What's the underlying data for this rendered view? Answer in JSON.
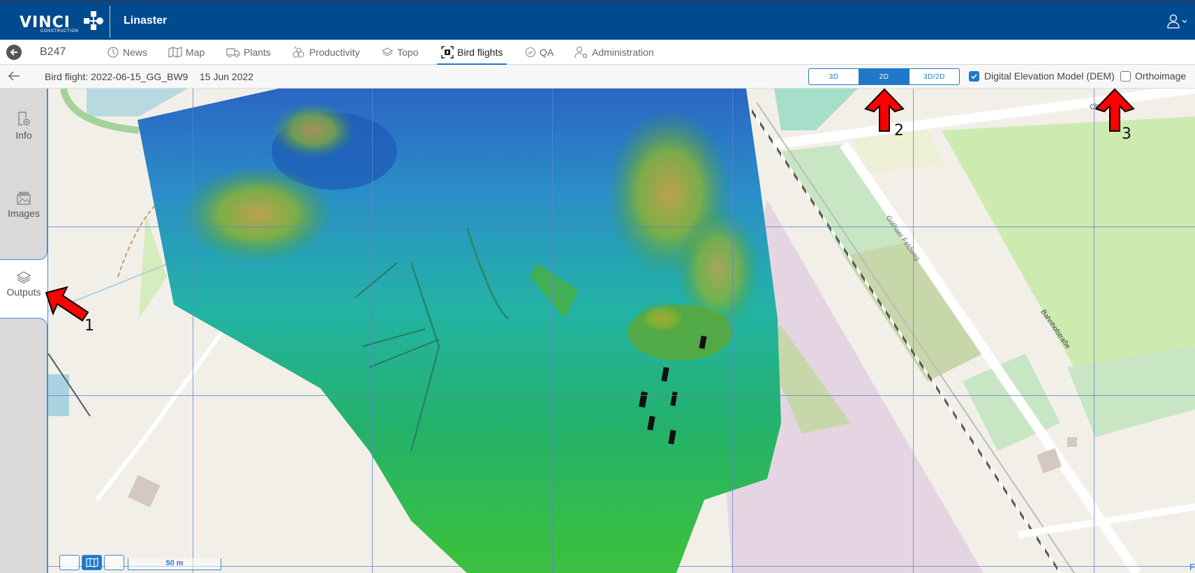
{
  "header": {
    "logo_text": "VINCI",
    "logo_subtext": "CONSTRUCTION",
    "app_name": "Linaster",
    "user_icon": "user-icon"
  },
  "nav": {
    "project": "B247",
    "tabs": [
      {
        "label": "News",
        "icon": "clock-icon",
        "active": false
      },
      {
        "label": "Map",
        "icon": "map-icon",
        "active": false
      },
      {
        "label": "Plants",
        "icon": "truck-icon",
        "active": false
      },
      {
        "label": "Productivity",
        "icon": "productivity-icon",
        "active": false
      },
      {
        "label": "Topo",
        "icon": "layers-icon",
        "active": false
      },
      {
        "label": "Bird flights",
        "icon": "drone-icon",
        "active": true
      },
      {
        "label": "QA",
        "icon": "check-circle-icon",
        "active": false
      },
      {
        "label": "Administration",
        "icon": "user-gear-icon",
        "active": false
      }
    ]
  },
  "subheader": {
    "flight_name": "Bird flight: 2022-06-15_GG_BW9",
    "flight_date": "15 Jun 2022",
    "view_modes": [
      {
        "label": "3D",
        "active": false
      },
      {
        "label": "2D",
        "active": true
      },
      {
        "label": "3D/2D",
        "active": false
      }
    ],
    "layers": [
      {
        "label": "Digital Elevation Model (DEM)",
        "checked": true
      },
      {
        "label": "Orthoimage",
        "checked": false
      }
    ]
  },
  "sidebar": {
    "items": [
      {
        "label": "Info",
        "icon": "info-doc-icon",
        "active": false
      },
      {
        "label": "Images",
        "icon": "images-icon",
        "active": false
      },
      {
        "label": "Outputs",
        "icon": "layers-icon",
        "active": true
      }
    ]
  },
  "map": {
    "street_labels": [
      "Oberer ...ße",
      "Gothaer Feldweg",
      "Bahnhofstraße"
    ],
    "scale_label": "50 m",
    "tools": [
      {
        "name": "image-view",
        "active": false
      },
      {
        "name": "map-view",
        "active": true
      },
      {
        "name": "blank-view",
        "active": false
      }
    ],
    "attribution": "F"
  },
  "annotations": [
    {
      "number": "1",
      "target": "Outputs"
    },
    {
      "number": "2",
      "target": "2D"
    },
    {
      "number": "3",
      "target": "Orthoimage"
    }
  ],
  "colors": {
    "header_bg": "#004a8f",
    "accent": "#1f78c8",
    "annotation_arrow": "#ff0000"
  }
}
